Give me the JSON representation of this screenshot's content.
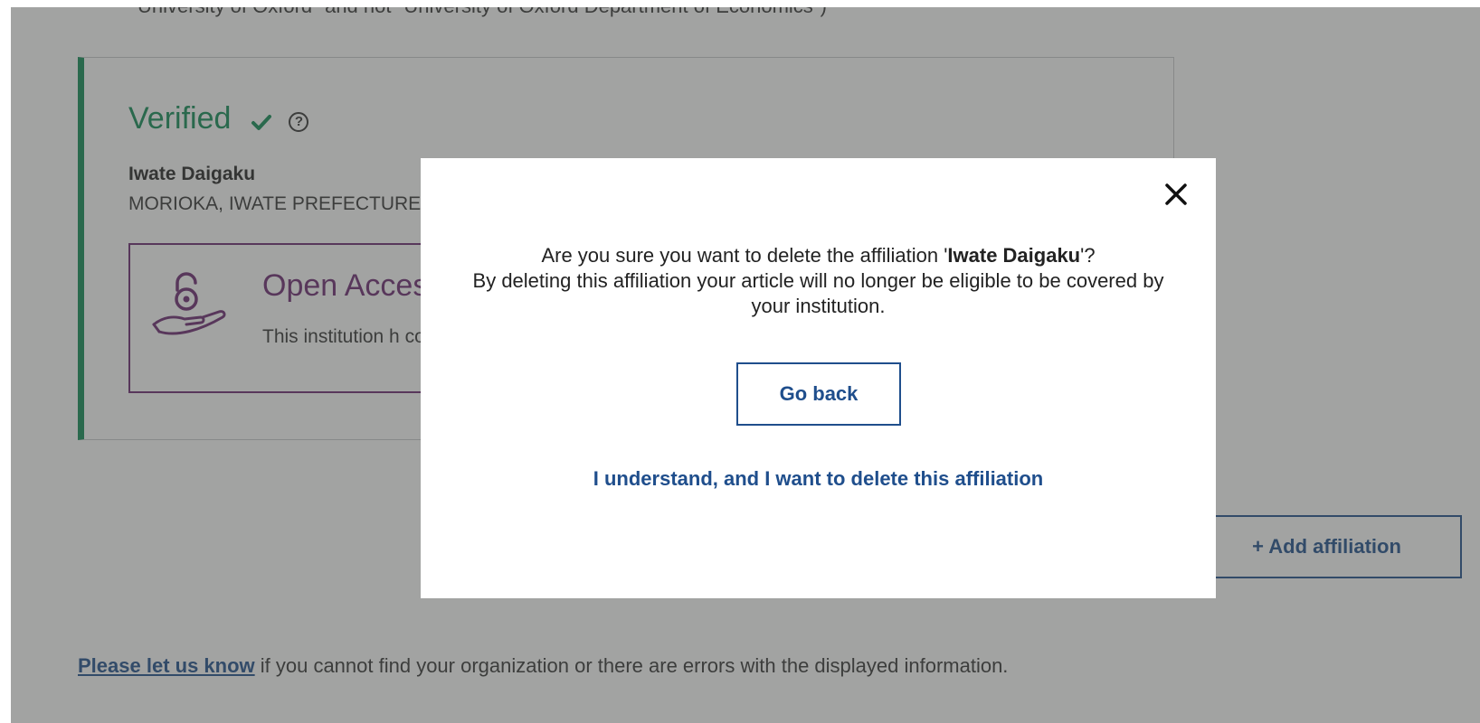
{
  "background": {
    "top_text": "University of Oxford\" and not \"University of Oxford Department of Economics\")",
    "card": {
      "status_title": "Verified",
      "institution_name": "Iwate Daigaku",
      "institution_location": "MORIOKA, IWATE PREFECTURE,",
      "open_access": {
        "title": "Open Acces",
        "description": "This institution h coverage."
      }
    },
    "add_affiliation_label": "+ Add affiliation",
    "footer": {
      "link_text": "Please let us know",
      "rest_text": " if you cannot find your organization or there are errors with the displayed information."
    }
  },
  "modal": {
    "question_prefix": "Are you sure you want to delete the affiliation '",
    "affiliation_name": "Iwate Daigaku",
    "question_suffix": "'?",
    "explanation": "By deleting this affiliation your article will no longer be eligible to be covered by your institution.",
    "go_back_label": "Go back",
    "confirm_label": "I understand, and I want to delete this affiliation"
  },
  "colors": {
    "verified_green": "#0f8a54",
    "open_access_purple": "#6b2770",
    "link_blue": "#1f4e8c",
    "overlay": "rgba(70,72,70,0.5)"
  },
  "icons": [
    "check-icon",
    "help-icon",
    "open-access-icon",
    "close-icon"
  ]
}
